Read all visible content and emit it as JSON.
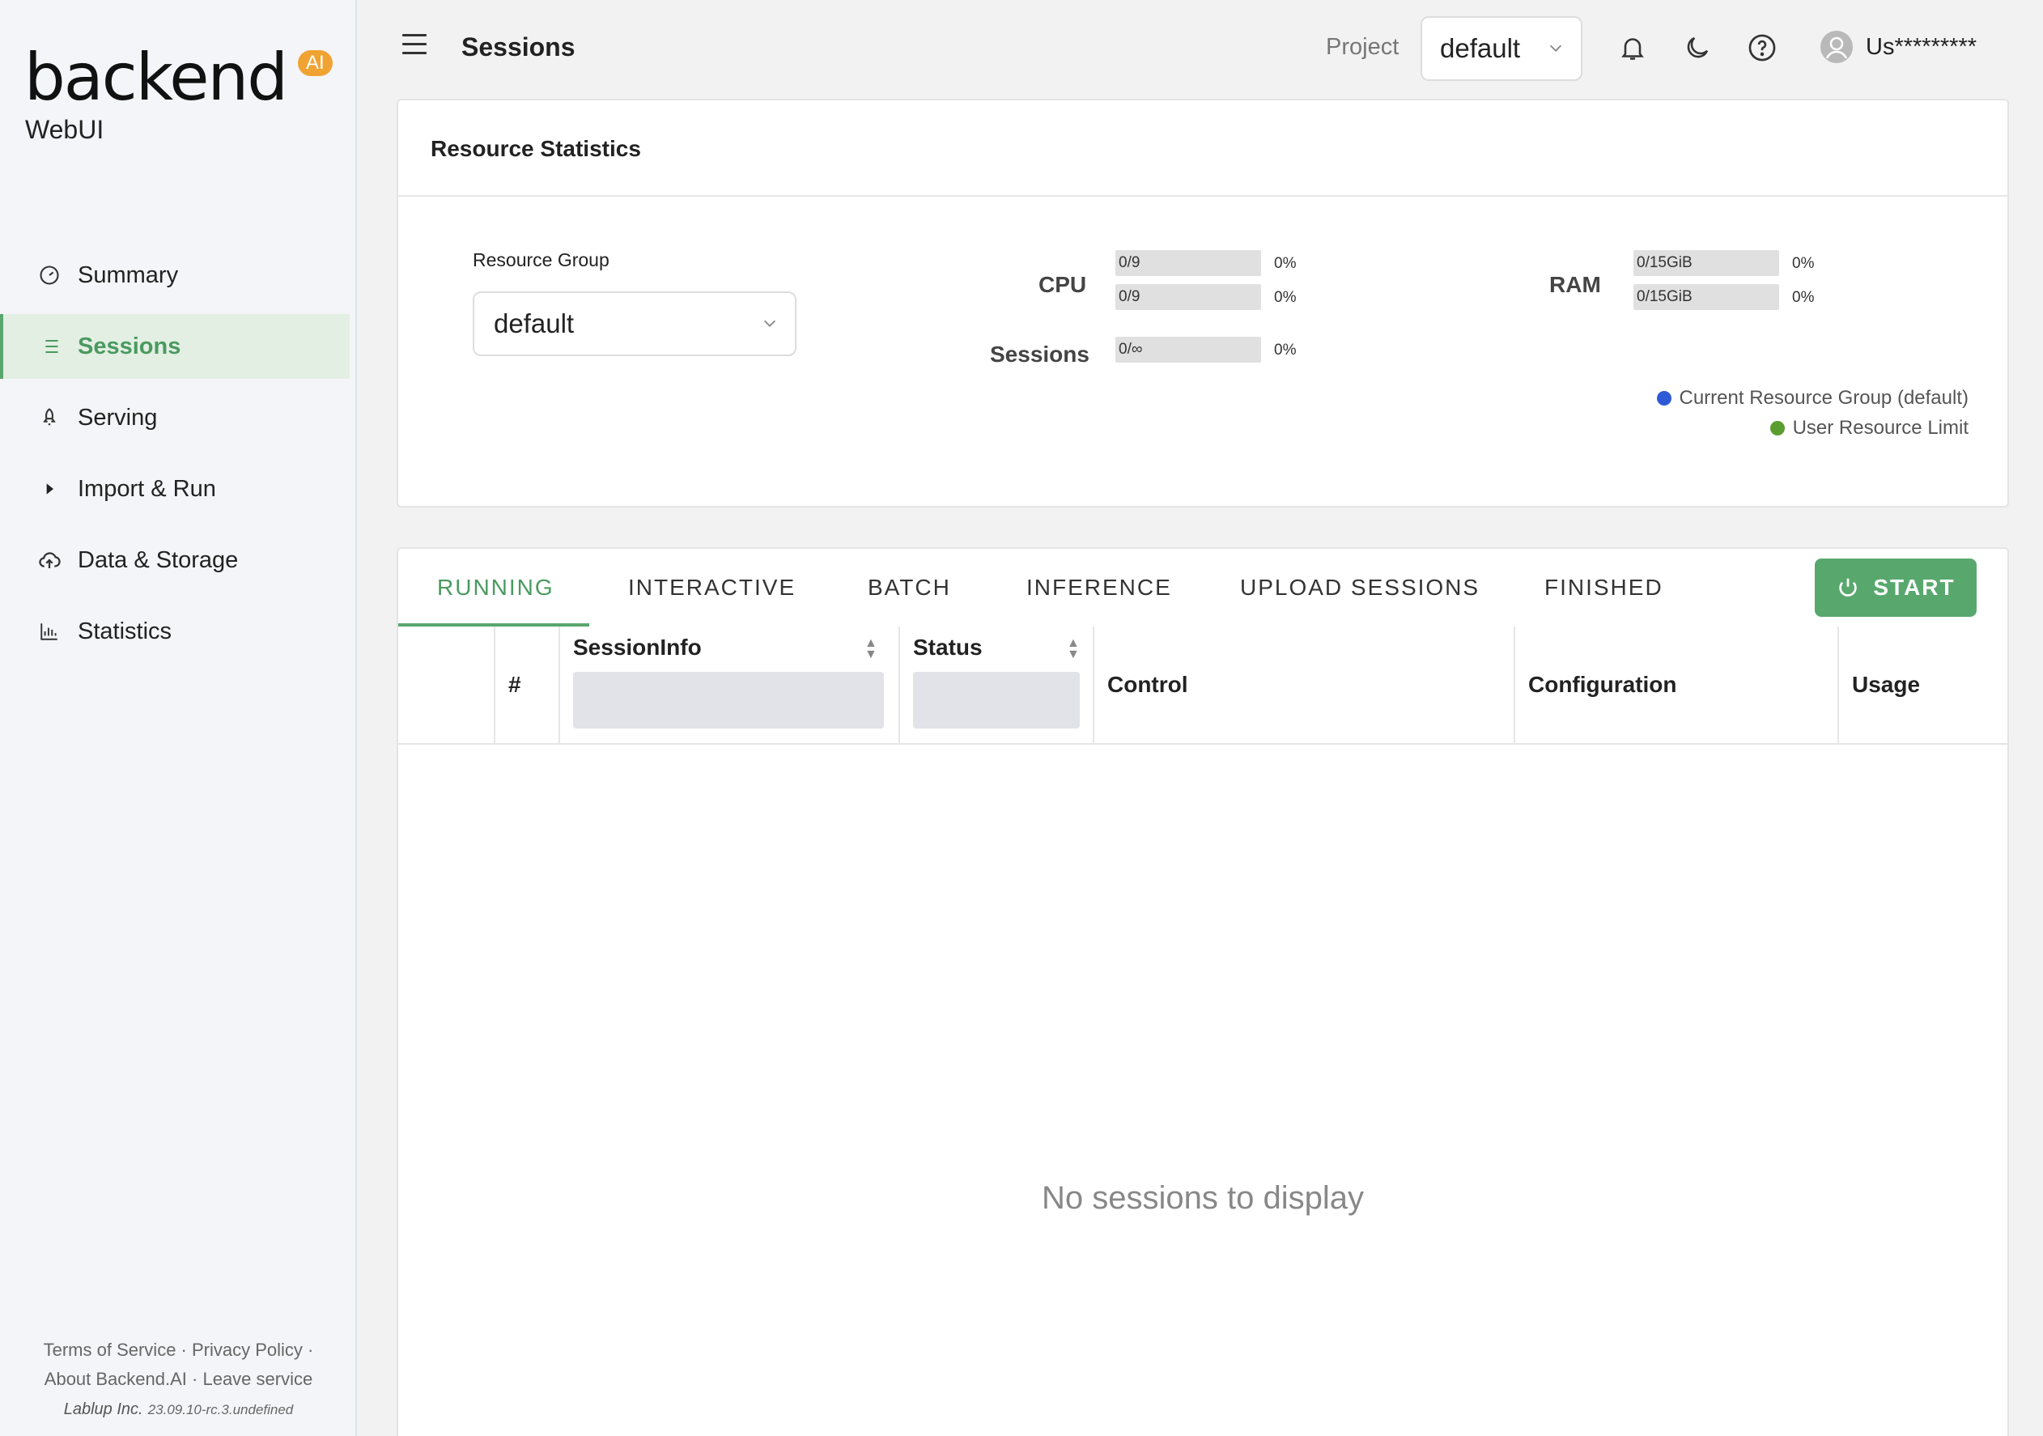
{
  "app": {
    "logo_text": "backend",
    "logo_badge": "AI",
    "logo_sub": "WebUI"
  },
  "sidebar": {
    "items": [
      {
        "label": "Summary",
        "icon": "dashboard-gauge-icon"
      },
      {
        "label": "Sessions",
        "icon": "list-icon",
        "active": true
      },
      {
        "label": "Serving",
        "icon": "rocket-icon"
      },
      {
        "label": "Import & Run",
        "icon": "caret-right-icon"
      },
      {
        "label": "Data & Storage",
        "icon": "cloud-upload-icon"
      },
      {
        "label": "Statistics",
        "icon": "bar-chart-icon"
      }
    ],
    "footer": {
      "terms": "Terms of Service",
      "privacy": "Privacy Policy",
      "about": "About Backend.AI",
      "leave": "Leave service",
      "company": "Lablup Inc.",
      "version": "23.09.10-rc.3.undefined"
    }
  },
  "header": {
    "title": "Sessions",
    "project_label": "Project",
    "project_value": "default",
    "user_name": "Us*********"
  },
  "stats": {
    "title": "Resource Statistics",
    "resource_group_label": "Resource Group",
    "resource_group_value": "default",
    "cpu_label": "CPU",
    "ram_label": "RAM",
    "sessions_label": "Sessions",
    "cpu": [
      {
        "text": "0/9",
        "pct": "0%",
        "fraction": 0
      },
      {
        "text": "0/9",
        "pct": "0%",
        "fraction": 0
      }
    ],
    "ram": [
      {
        "text": "0/15GiB",
        "pct": "0%",
        "fraction": 0
      },
      {
        "text": "0/15GiB",
        "pct": "0%",
        "fraction": 0
      }
    ],
    "sessions": {
      "text": "0/∞",
      "pct": "0%",
      "fraction": 0
    },
    "legend": [
      {
        "label": "Current Resource Group (default)",
        "color": "#2f5ad6"
      },
      {
        "label": "User Resource Limit",
        "color": "#5a9e2f"
      }
    ]
  },
  "tabs": [
    {
      "label": "RUNNING",
      "active": true
    },
    {
      "label": "INTERACTIVE"
    },
    {
      "label": "BATCH"
    },
    {
      "label": "INFERENCE"
    },
    {
      "label": "UPLOAD SESSIONS"
    },
    {
      "label": "FINISHED"
    }
  ],
  "start_button": "START",
  "table": {
    "columns": {
      "index": "#",
      "session_info": "SessionInfo",
      "status": "Status",
      "control": "Control",
      "configuration": "Configuration",
      "usage": "Usage"
    },
    "empty_text": "No sessions to display"
  },
  "colors": {
    "accent": "#5aa66e",
    "accent_text": "#4a9a60",
    "ai_badge": "#f0a332"
  }
}
